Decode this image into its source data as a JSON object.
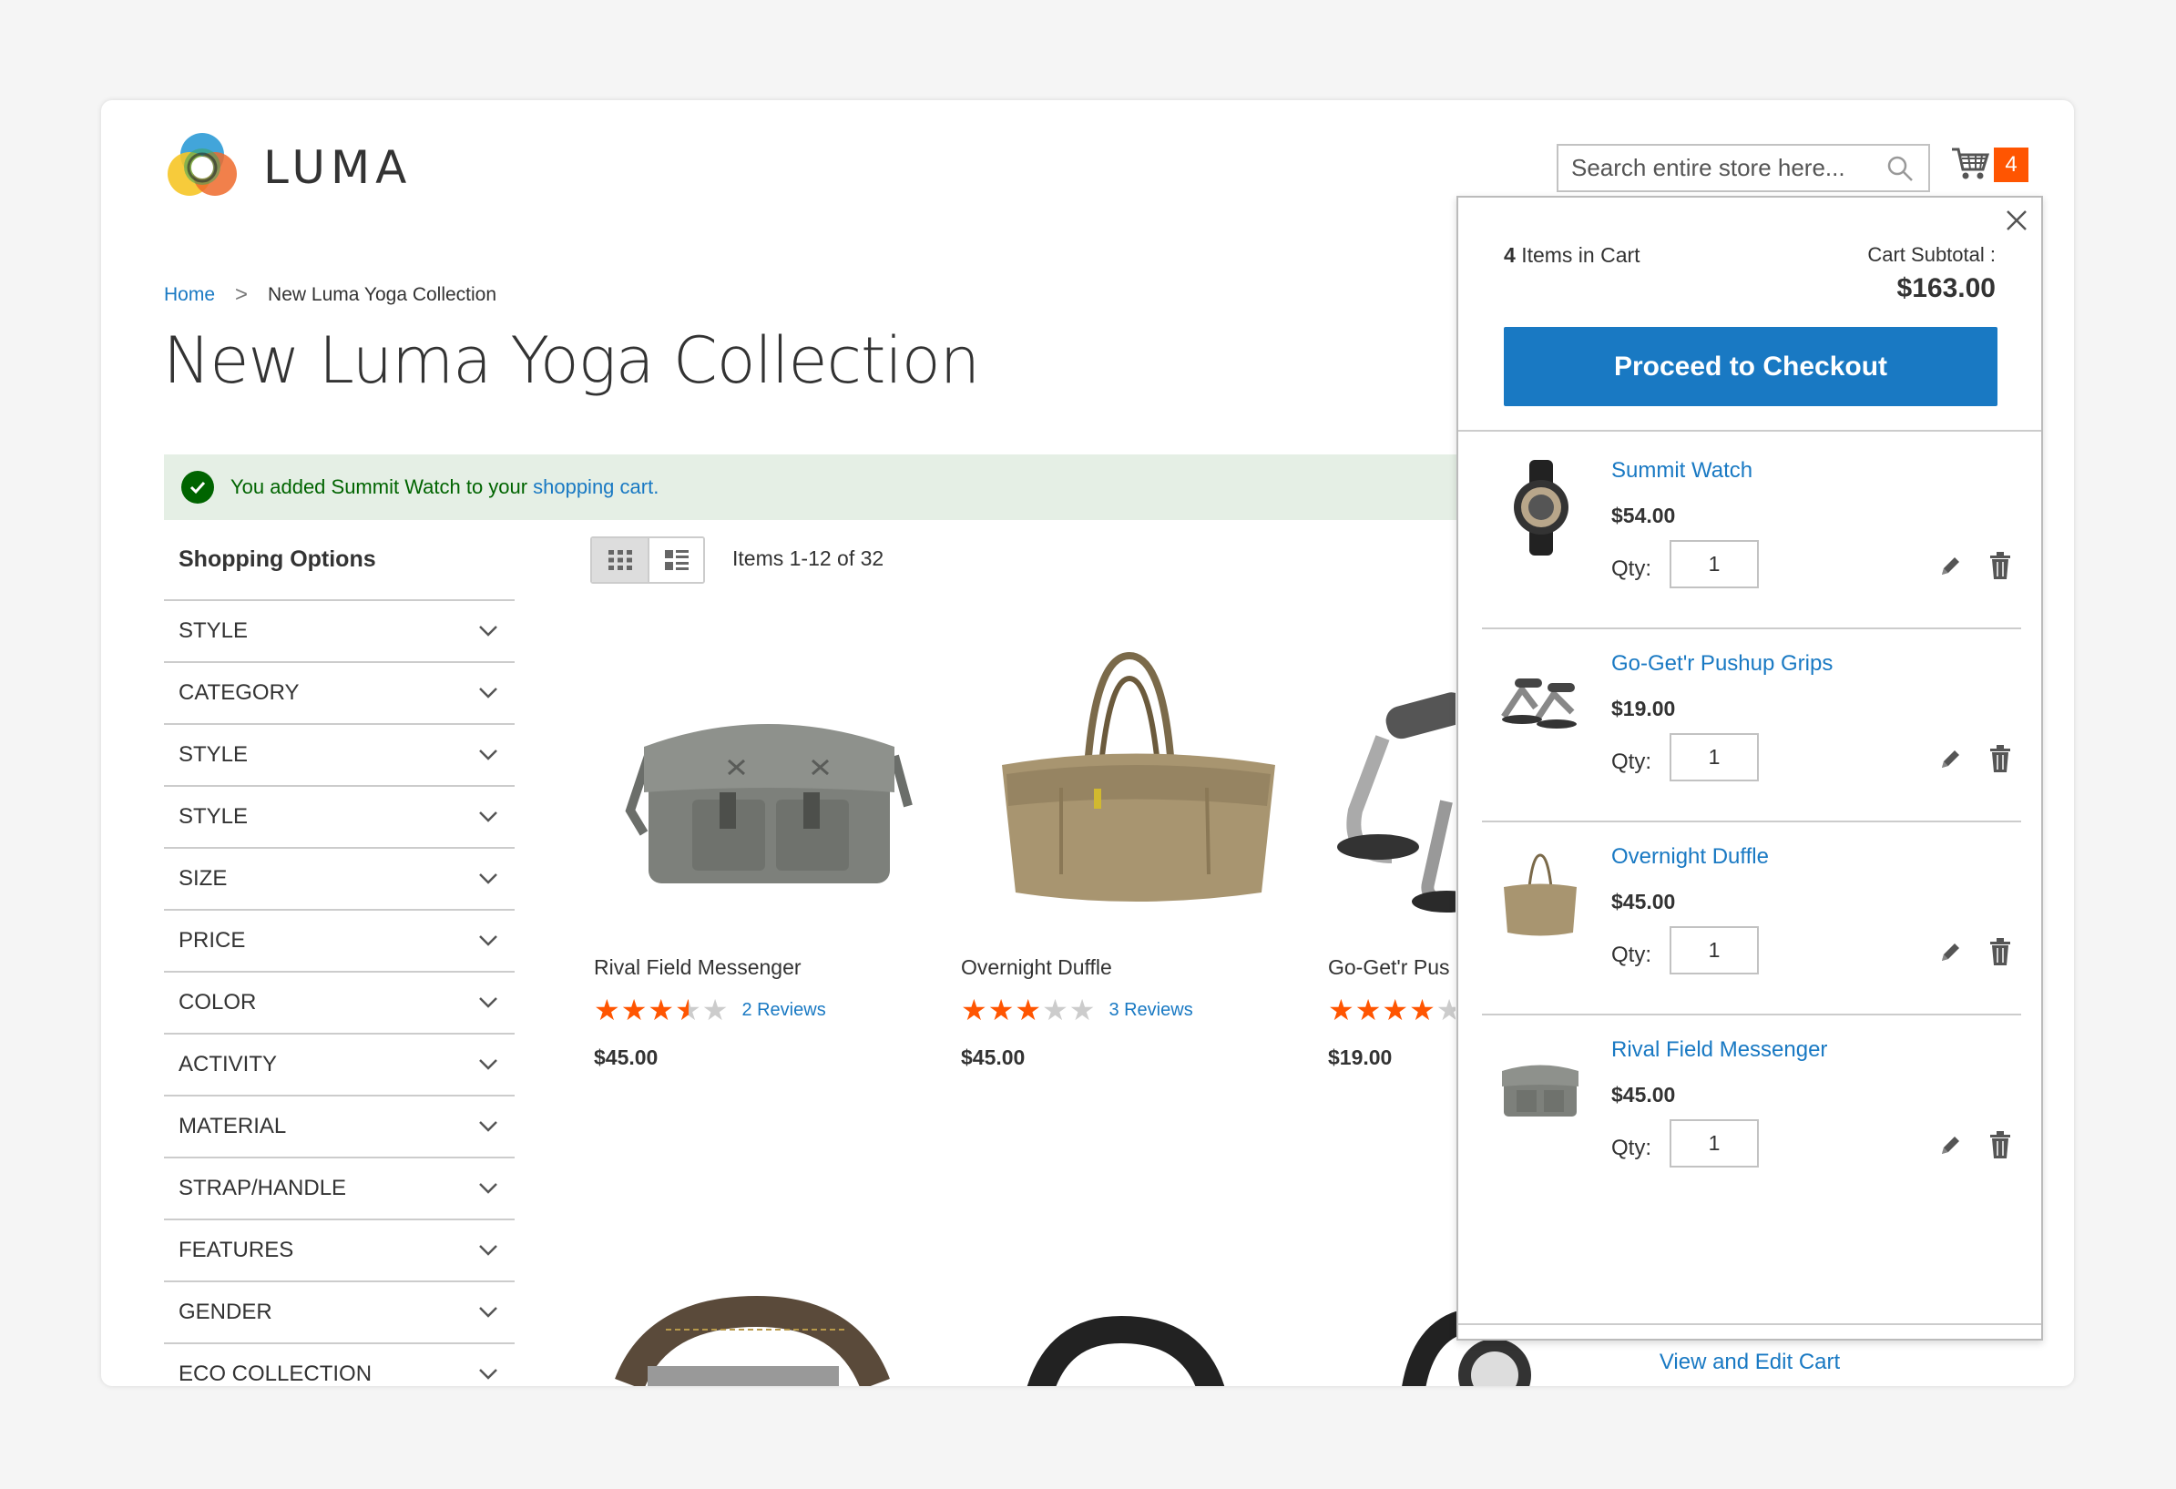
{
  "header": {
    "logo_text": "LUMA",
    "search_placeholder": "Search entire store here...",
    "cart_count": "4"
  },
  "breadcrumb": {
    "home": "Home",
    "separator": ">",
    "current": "New Luma Yoga Collection"
  },
  "page_title": "New Luma Yoga Collection",
  "message": {
    "text": "You added Summit Watch to your",
    "link": "shopping cart."
  },
  "sidebar": {
    "title": "Shopping Options",
    "filters": [
      "STYLE",
      "CATEGORY",
      "STYLE",
      "STYLE",
      "SIZE",
      "PRICE",
      "COLOR",
      "ACTIVITY",
      "MATERIAL",
      "STRAP/HANDLE",
      "FEATURES",
      "GENDER",
      "ECO COLLECTION"
    ]
  },
  "toolbar": {
    "amount": "Items 1-12 of 32"
  },
  "products": [
    {
      "name": "Rival Field Messenger",
      "rating": 3.5,
      "reviews": "2  Reviews",
      "price": "$45.00"
    },
    {
      "name": "Overnight Duffle",
      "rating": 3,
      "reviews": "3  Reviews",
      "price": "$45.00"
    },
    {
      "name": "Go-Get'r Pus",
      "rating": 4,
      "reviews": "",
      "price": "$19.00"
    }
  ],
  "minicart": {
    "count_num": "4",
    "count_text": "Items in Cart",
    "subtotal_label": "Cart Subtotal :",
    "subtotal": "$163.00",
    "checkout_label": "Proceed to Checkout",
    "qty_label": "Qty:",
    "items": [
      {
        "name": "Summit Watch",
        "price": "$54.00",
        "qty": "1"
      },
      {
        "name": "Go-Get'r Pushup Grips",
        "price": "$19.00",
        "qty": "1"
      },
      {
        "name": "Overnight Duffle",
        "price": "$45.00",
        "qty": "1"
      },
      {
        "name": "Rival Field Messenger",
        "price": "$45.00",
        "qty": "1"
      }
    ],
    "view_cart": "View and Edit Cart"
  },
  "colors": {
    "accent": "#1979c3",
    "badge": "#ff5501",
    "success_bg": "#e5efe5",
    "success_text": "#006400",
    "star": "#ff5501"
  }
}
